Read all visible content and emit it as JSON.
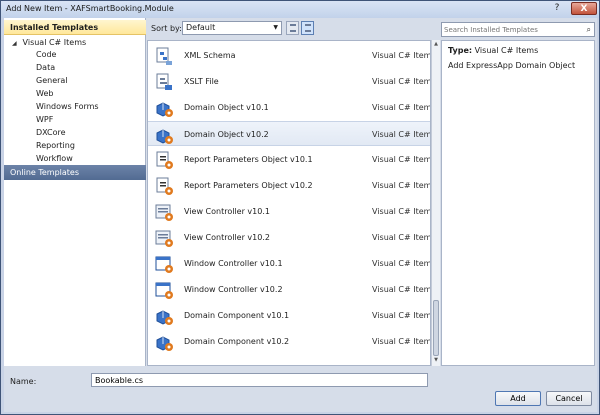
{
  "window": {
    "title": "Add New Item - XAFSmartBooking.Module",
    "help": "?",
    "close": "X"
  },
  "left": {
    "installed_header": "Installed Templates",
    "root": "Visual C# Items",
    "items": [
      "Code",
      "Data",
      "General",
      "Web",
      "Windows Forms",
      "WPF",
      "DXCore",
      "Reporting",
      "Workflow"
    ],
    "online_header": "Online Templates"
  },
  "sort": {
    "label": "Sort by:",
    "value": "Default"
  },
  "search": {
    "placeholder": "Search Installed Templates"
  },
  "templates": [
    {
      "name": "XML Schema",
      "category": "Visual C# Items",
      "icon": "xml-schema-icon",
      "selected": false
    },
    {
      "name": "XSLT File",
      "category": "Visual C# Items",
      "icon": "xslt-file-icon",
      "selected": false
    },
    {
      "name": "Domain Object v10.1",
      "category": "Visual C# Items",
      "icon": "domain-object-icon",
      "selected": false
    },
    {
      "name": "Domain Object v10.2",
      "category": "Visual C# Items",
      "icon": "domain-object-icon",
      "selected": true
    },
    {
      "name": "Report Parameters Object v10.1",
      "category": "Visual C# Items",
      "icon": "report-parameters-icon",
      "selected": false
    },
    {
      "name": "Report Parameters Object v10.2",
      "category": "Visual C# Items",
      "icon": "report-parameters-icon",
      "selected": false
    },
    {
      "name": "View Controller  v10.1",
      "category": "Visual C# Items",
      "icon": "view-controller-icon",
      "selected": false
    },
    {
      "name": "View Controller  v10.2",
      "category": "Visual C# Items",
      "icon": "view-controller-icon",
      "selected": false
    },
    {
      "name": "Window Controller v10.1",
      "category": "Visual C# Items",
      "icon": "window-controller-icon",
      "selected": false
    },
    {
      "name": "Window Controller v10.2",
      "category": "Visual C# Items",
      "icon": "window-controller-icon",
      "selected": false
    },
    {
      "name": "Domain Component v10.1",
      "category": "Visual C# Items",
      "icon": "domain-component-icon",
      "selected": false
    },
    {
      "name": "Domain Component v10.2",
      "category": "Visual C# Items",
      "icon": "domain-component-icon",
      "selected": false
    }
  ],
  "detail": {
    "type_label": "Type:",
    "type_value": "Visual C# Items",
    "description": "Add ExpressApp Domain Object"
  },
  "name_field": {
    "label": "Name:",
    "value": "Bookable.cs"
  },
  "buttons": {
    "add": "Add",
    "cancel": "Cancel"
  },
  "colors": {
    "accent": "#526b92",
    "highlight": "#ffe89b",
    "gear": "#e07a1f",
    "blue": "#3a73c8"
  }
}
